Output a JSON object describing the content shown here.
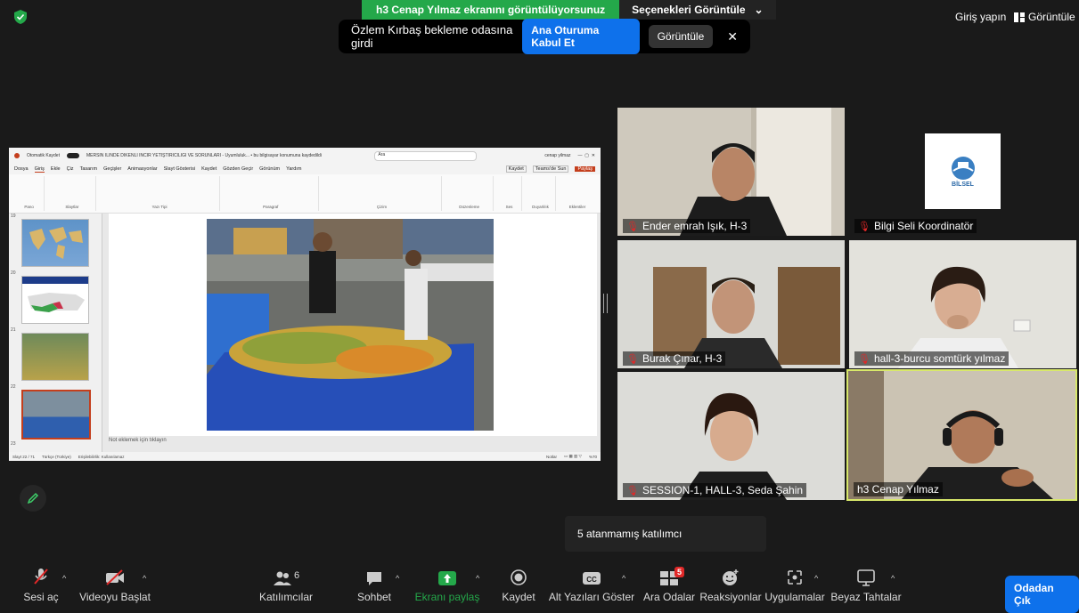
{
  "top": {
    "share_banner": "h3 Cenap Yılmaz ekranını görüntülüyorsunuz",
    "view_options": "Seçenekleri Görüntüle",
    "notification": "Özlem Kırbaş bekleme odasına girdi",
    "admit_button": "Ana Oturuma Kabul Et",
    "view_button": "Görüntüle",
    "close": "✕",
    "sign_in": "Giriş yapın",
    "view_mode": "Görüntüle"
  },
  "ppt": {
    "doc_title": "MERSİN İLİNDE DİKENLİ İNCİR YETİŞTİRİCİLİĞİ VE SORUNLARI - Uyumluluk... • bu bilgisayar konumuna kaydedildi",
    "autosave": "Otomatik Kaydet",
    "search": "Ara",
    "user": "cenap yilmaz",
    "menu": [
      "Dosya",
      "Giriş",
      "Ekle",
      "Çiz",
      "Tasarım",
      "Geçişler",
      "Animasyonlar",
      "Slayt Gösterisi",
      "Kaydet",
      "Gözden Geçir",
      "Görünüm",
      "Yardım"
    ],
    "ribbon_groups": [
      "Pano",
      "Slaytlar",
      "Yazı Tipi",
      "Paragraf",
      "Çizim",
      "Düzenleme",
      "Ses",
      "Duyarlılık",
      "Eklentiler"
    ],
    "right_buttons": [
      "Kaydet",
      "Teams'de Sun",
      "Paylaş"
    ],
    "slide_numbers": [
      "19",
      "20",
      "21",
      "22",
      "23"
    ],
    "notes": "Not eklemek için tıklayın",
    "status": [
      "Slayt 22 / 71",
      "Türkçe (Türkiye)",
      "Erişilebilirlik: Kullanılamaz",
      "Notlar",
      "%70"
    ]
  },
  "participants": [
    {
      "name": "Ender emrah Işık, H-3",
      "muted": true
    },
    {
      "name": "Bilgi Seli Koordinatör",
      "muted": true,
      "logo_text": "BİLSEL"
    },
    {
      "name": "Burak Çınar, H-3",
      "muted": true
    },
    {
      "name": "hall-3-burcu somtürk yılmaz",
      "muted": true
    },
    {
      "name": "SESSION-1, HALL-3, Seda Şahin",
      "muted": true
    },
    {
      "name": "h3 Cenap Yılmaz",
      "muted": false,
      "active_speaker": true
    }
  ],
  "tooltip": "5 atanmamış katılımcı",
  "toolbar": {
    "audio": "Sesi aç",
    "video": "Videoyu Başlat",
    "participants": "Katılımcılar",
    "participants_count": "6",
    "chat": "Sohbet",
    "share": "Ekranı paylaş",
    "record": "Kaydet",
    "captions": "Alt Yazıları Göster",
    "breakout": "Ara Odalar",
    "breakout_badge": "5",
    "reactions": "Reaksiyonlar",
    "apps": "Uygulamalar",
    "whiteboard": "Beyaz Tahtalar",
    "leave": "Odadan Çık"
  },
  "colors": {
    "accent": "#0e71eb",
    "share_green": "#24a84a",
    "active_speaker": "#d8e86a",
    "mute_red": "#e02828"
  }
}
